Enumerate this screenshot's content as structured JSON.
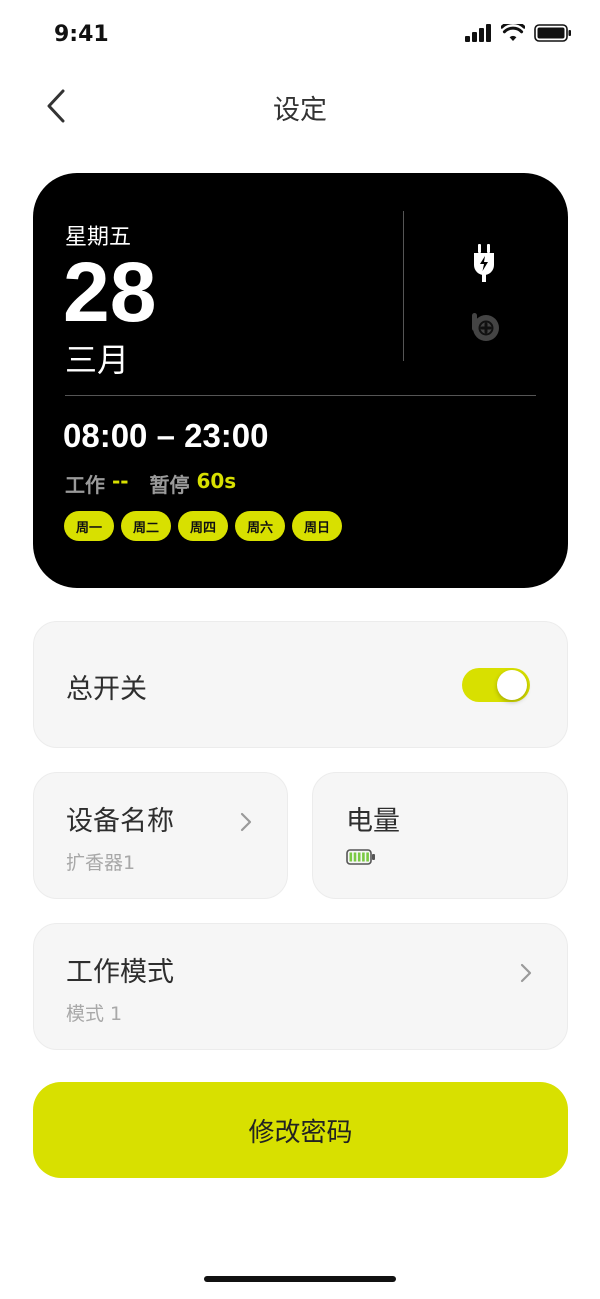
{
  "status_bar": {
    "time": "9:41"
  },
  "header": {
    "title": "设定"
  },
  "card": {
    "weekday": "星期五",
    "day": "28",
    "month": "三月",
    "time_range": "08:00 – 23:00",
    "work_label": "工作",
    "work_value": "--",
    "pause_label": "暂停",
    "pause_value": "60s",
    "days": [
      "周一",
      "周二",
      "周四",
      "周六",
      "周日"
    ]
  },
  "master_switch": {
    "label": "总开关",
    "on": true
  },
  "device_name": {
    "label": "设备名称",
    "value": "扩香器1"
  },
  "battery": {
    "label": "电量",
    "level": 1.0
  },
  "work_mode": {
    "label": "工作模式",
    "value": "模式 1"
  },
  "change_password": {
    "label": "修改密码"
  },
  "colors": {
    "accent": "#d8e000",
    "card_bg": "#000000",
    "panel_bg": "#f6f6f6",
    "battery_fill": "#7ac943"
  },
  "icons": [
    "back-arrow-icon",
    "plug-icon",
    "b-logo-icon",
    "chevron-right-icon",
    "battery-icon",
    "signal-icon",
    "wifi-icon"
  ]
}
